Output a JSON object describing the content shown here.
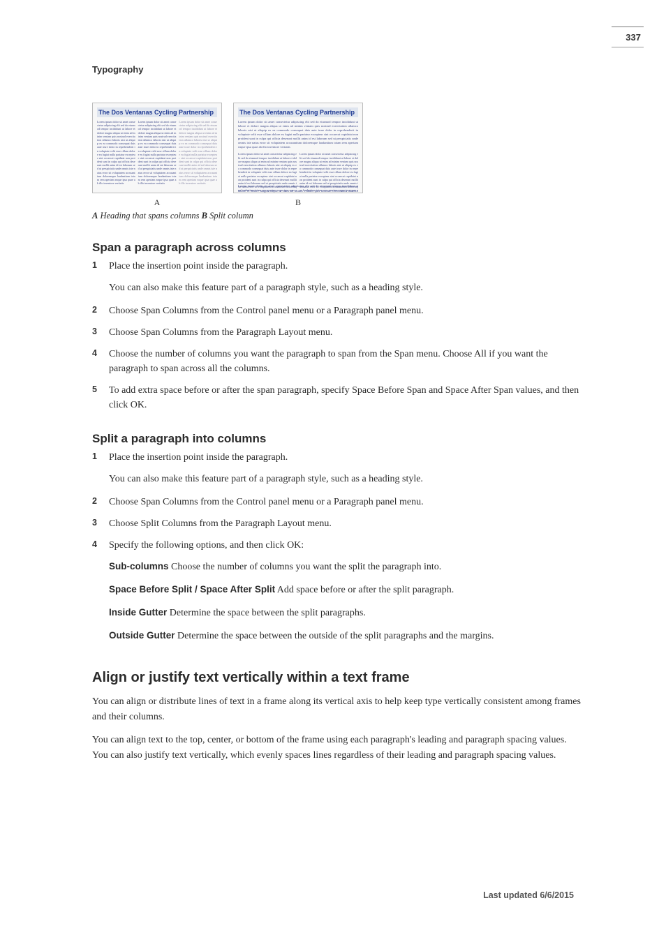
{
  "page_number": "337",
  "top_label": "Typography",
  "illustration": {
    "title_a": "The Dos Ventanas Cycling Partnership",
    "title_b": "The Dos Ventanas Cycling Partnership",
    "letter_a": "A",
    "letter_b": "B",
    "caption_a_bold": "A",
    "caption_a_text": " Heading that spans columns  ",
    "caption_b_bold": "B",
    "caption_b_text": " Split column"
  },
  "section_span": {
    "heading": "Span a paragraph across columns",
    "steps": [
      "Place the insertion point inside the paragraph.",
      "Choose Span Columns from the Control panel menu or a Paragraph panel menu.",
      "Choose Span Columns from the Paragraph Layout menu.",
      "Choose the number of columns you want the paragraph to span from the Span menu. Choose All if you want the paragraph to span across all the columns.",
      "To add extra space before or after the span paragraph, specify Space Before Span and Space After Span values, and then click OK."
    ],
    "after_step1": "You can also make this feature part of a paragraph style, such as a heading style."
  },
  "section_split": {
    "heading": "Split a paragraph into columns",
    "steps": [
      "Place the insertion point inside the paragraph.",
      "Choose Span Columns from the Control panel menu or a Paragraph panel menu.",
      "Choose Split Columns from the Paragraph Layout menu.",
      "Specify the following options, and then click OK:"
    ],
    "after_step1": "You can also make this feature part of a paragraph style, such as a heading style.",
    "options": [
      {
        "label": "Sub-columns",
        "text": "  Choose the number of columns you want the split the paragraph into."
      },
      {
        "label": "Space Before Split / Space After Split",
        "text": "  Add space before or after the split paragraph."
      },
      {
        "label": "Inside Gutter",
        "text": "  Determine the space between the split paragraphs."
      },
      {
        "label": "Outside Gutter",
        "text": "  Determine the space between the outside of the split paragraphs and the margins."
      }
    ]
  },
  "section_align": {
    "heading": "Align or justify text vertically within a text frame",
    "p1": "You can align or distribute lines of text in a frame along its vertical axis to help keep type vertically consistent among frames and their columns.",
    "p2": "You can align text to the top, center, or bottom of the frame using each paragraph's leading and paragraph spacing values. You can also justify text vertically, which evenly spaces lines regardless of their leading and paragraph spacing values."
  },
  "footer": "Last updated 6/6/2015",
  "greek": "Lorem ipsum dolor sit amet consectetur adipiscing elit sed do eiusmod tempor incididunt ut labore et dolore magna aliqua ut enim ad minim veniam quis nostrud exercitation ullamco laboris nisi ut aliquip ex ea commodo consequat duis aute irure dolor in reprehenderit in voluptate velit esse cillum dolore eu fugiat nulla pariatur excepteur sint occaecat cupidatat non proident sunt in culpa qui officia deserunt mollit anim id est laborum sed ut perspiciatis unde omnis iste natus error sit voluptatem accusantium doloremque laudantium totam rem aperiam eaque ipsa quae ab illo inventore veritatis"
}
